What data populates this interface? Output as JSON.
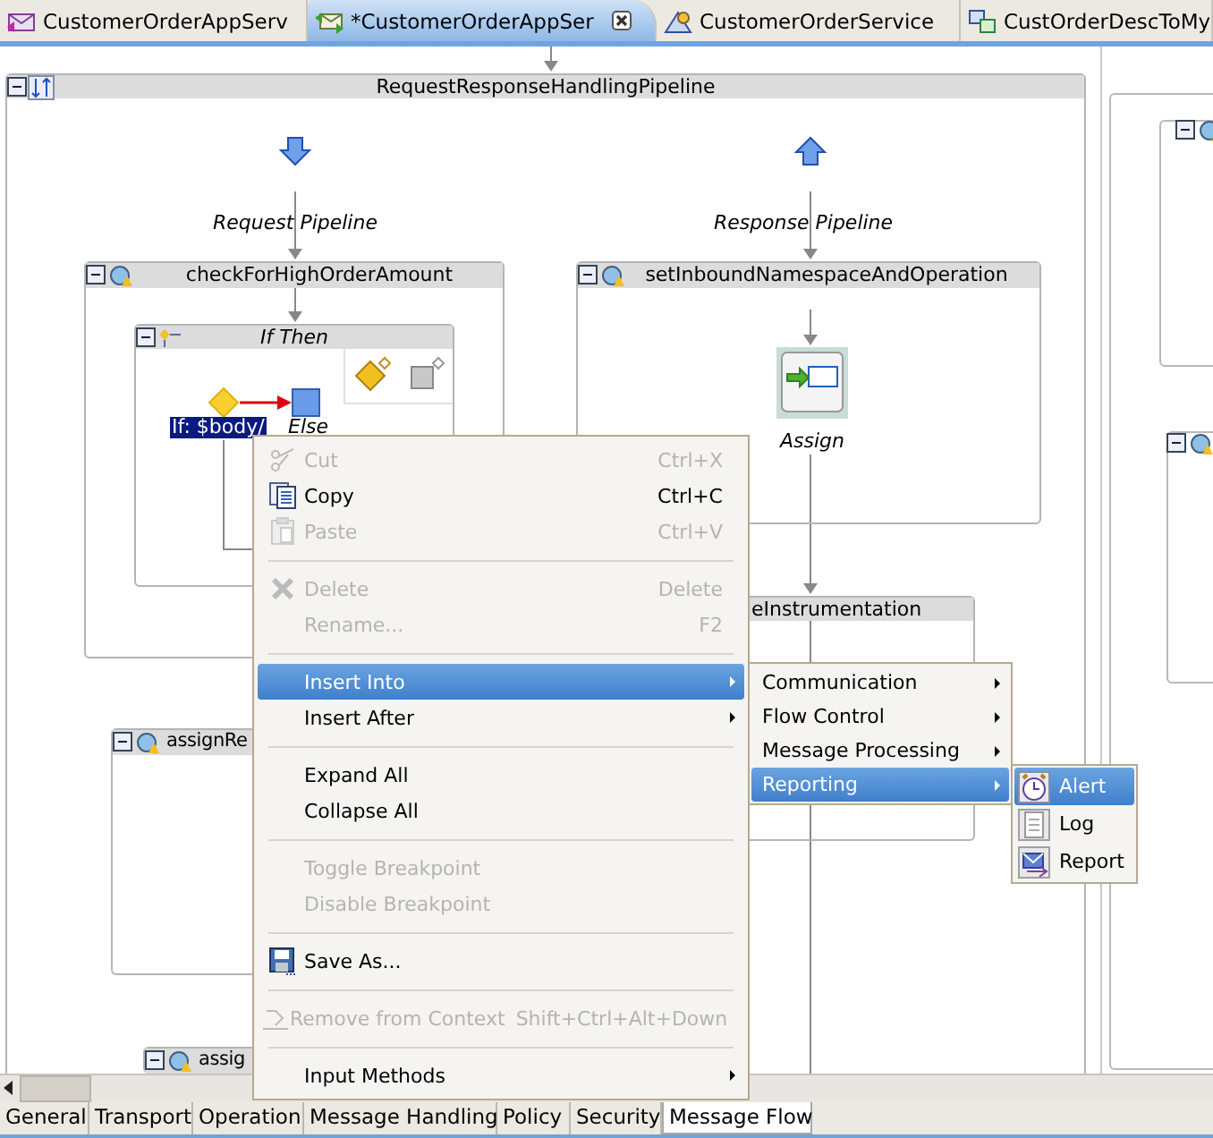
{
  "editor_tabs": [
    {
      "label": "CustomerOrderAppServ",
      "selected": false
    },
    {
      "label": "*CustomerOrderAppSer",
      "selected": true
    },
    {
      "label": "CustomerOrderService",
      "selected": false
    },
    {
      "label": "CustOrderDescToMy",
      "selected": false
    }
  ],
  "pipeline": {
    "title": "RequestResponseHandlingPipeline",
    "request_label": "Request Pipeline",
    "response_label": "Response Pipeline"
  },
  "stages": [
    {
      "name": "checkForHighOrderAmount"
    },
    {
      "name": "setInboundNamespaceAndOperation"
    },
    {
      "name": "eInstrumentation"
    },
    {
      "name": "assignRe"
    },
    {
      "name": "assig"
    }
  ],
  "if_then": {
    "title": "If Then",
    "condition": "If: $body/",
    "condition_selected": true,
    "else_label": "Else"
  },
  "assign": {
    "label": "Assign"
  },
  "context_menu": {
    "groups": [
      [
        {
          "label": "Cut",
          "shortcut": "Ctrl+X",
          "disabled": true,
          "selected": false,
          "submenu": false
        },
        {
          "label": "Copy",
          "shortcut": "Ctrl+C",
          "disabled": false,
          "selected": false,
          "submenu": false
        },
        {
          "label": "Paste",
          "shortcut": "Ctrl+V",
          "disabled": true,
          "selected": false,
          "submenu": false
        }
      ],
      [
        {
          "label": "Delete",
          "shortcut": "Delete",
          "disabled": true,
          "selected": false,
          "submenu": false
        },
        {
          "label": "Rename...",
          "shortcut": "F2",
          "disabled": true,
          "selected": false,
          "submenu": false
        }
      ],
      [
        {
          "label": "Insert Into",
          "disabled": false,
          "selected": true,
          "submenu": true
        },
        {
          "label": "Insert After",
          "disabled": false,
          "selected": false,
          "submenu": true
        }
      ],
      [
        {
          "label": "Expand All",
          "disabled": false,
          "selected": false,
          "submenu": false
        },
        {
          "label": "Collapse All",
          "disabled": false,
          "selected": false,
          "submenu": false
        }
      ],
      [
        {
          "label": "Toggle Breakpoint",
          "disabled": true,
          "selected": false,
          "submenu": false
        },
        {
          "label": "Disable Breakpoint",
          "disabled": true,
          "selected": false,
          "submenu": false
        }
      ],
      [
        {
          "label": "Save As...",
          "disabled": false,
          "selected": false,
          "submenu": false
        }
      ],
      [
        {
          "label": "Remove from Context",
          "shortcut": "Shift+Ctrl+Alt+Down",
          "disabled": true,
          "selected": false,
          "submenu": false
        }
      ],
      [
        {
          "label": "Input Methods",
          "disabled": false,
          "selected": false,
          "submenu": true
        }
      ]
    ]
  },
  "insert_submenu": [
    {
      "label": "Communication",
      "selected": false,
      "submenu": true
    },
    {
      "label": "Flow Control",
      "selected": false,
      "submenu": true
    },
    {
      "label": "Message Processing",
      "selected": false,
      "submenu": true
    },
    {
      "label": "Reporting",
      "selected": true,
      "submenu": true
    }
  ],
  "reporting_submenu": [
    {
      "label": "Alert",
      "selected": true
    },
    {
      "label": "Log",
      "selected": false
    },
    {
      "label": "Report",
      "selected": false
    }
  ],
  "bottom_tabs": [
    {
      "label": "General",
      "selected": false
    },
    {
      "label": "Transport",
      "selected": false
    },
    {
      "label": "Operation",
      "selected": false
    },
    {
      "label": "Message Handling",
      "selected": false
    },
    {
      "label": "Policy",
      "selected": false
    },
    {
      "label": "Security",
      "selected": false
    },
    {
      "label": "Message Flow",
      "selected": true
    }
  ]
}
